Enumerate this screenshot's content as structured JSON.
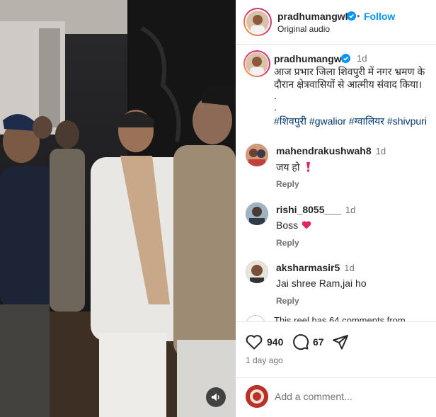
{
  "post": {
    "username": "pradhumangwl",
    "audio": "Original audio",
    "follow_label": "Follow",
    "follow_dot": "•",
    "time": "1d",
    "caption_line1": "आज प्रभार जिला शिवपुरी में नगर भ्रमण के",
    "caption_line2": "दौरान क्षेत्रवासियों से आत्मीय संवाद किया।",
    "caption_dot1": ".",
    "caption_dot2": ".",
    "hashtags": "#शिवपुरी #gwalior #ग्वालियर #shivpuri"
  },
  "comments": [
    {
      "username": "mahendrakushwah8",
      "time": "1d",
      "text": "जय हो",
      "reply": "Reply",
      "avatar_color": "#8a6a58"
    },
    {
      "username": "rishi_8055___",
      "time": "1d",
      "text": "Boss",
      "reply": "Reply",
      "avatar_color": "#5b6c7a"
    },
    {
      "username": "aksharmasir5",
      "time": "1d",
      "text": "Jai shree Ram,jai ho",
      "reply": "Reply",
      "avatar_color": "#6b4a3a"
    }
  ],
  "more_comments_text": "This reel has 64 comments from",
  "actions": {
    "likes": "940",
    "comments": "67",
    "posted": "1 day ago"
  },
  "add_comment": {
    "placeholder": "Add a comment..."
  },
  "colors": {
    "accent": "#0095f6",
    "verified": "#0095f6",
    "heart_emoji": "#e0245e"
  }
}
